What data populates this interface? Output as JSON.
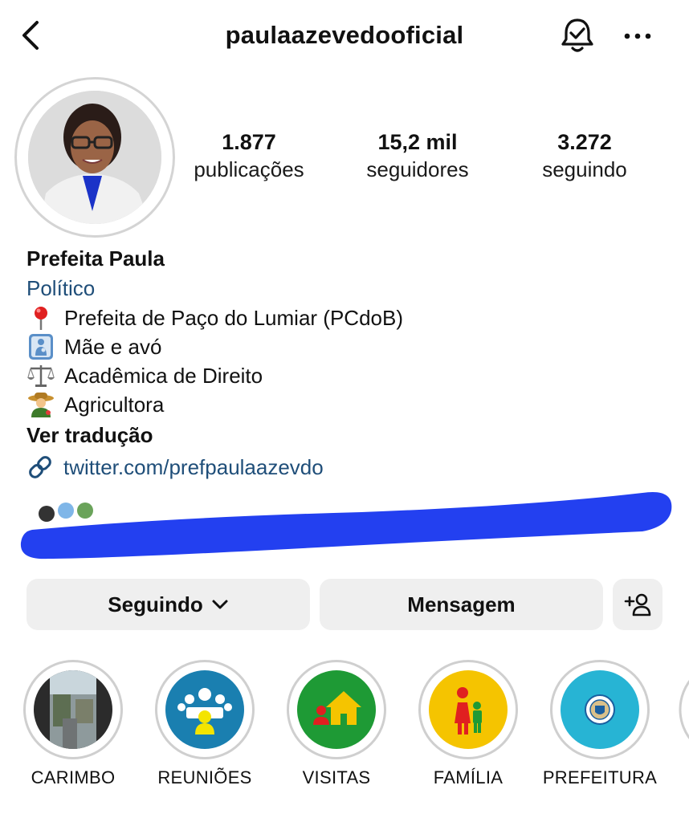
{
  "header": {
    "username": "paulaazevedooficial",
    "back_icon": "chevron-left-icon",
    "bell_icon": "bell-check-icon",
    "more_icon": "more-horizontal-icon"
  },
  "stats": {
    "posts": {
      "value": "1.877",
      "label": "publicações"
    },
    "followers": {
      "value": "15,2 mil",
      "label": "seguidores"
    },
    "following": {
      "value": "3.272",
      "label": "seguindo"
    }
  },
  "bio": {
    "name": "Prefeita Paula",
    "category": "Político",
    "lines": [
      {
        "emoji": "pin-emoji",
        "text": "Prefeita de Paço do Lumiar (PCdoB)"
      },
      {
        "emoji": "mother-child-emoji",
        "text": "Mãe e avó"
      },
      {
        "emoji": "scales-emoji",
        "text": "Acadêmica de Direito"
      },
      {
        "emoji": "farmer-emoji",
        "text": "Agricultora"
      }
    ],
    "see_translation": "Ver tradução",
    "link": "twitter.com/prefpaulaazevdo"
  },
  "actions": {
    "following_label": "Seguindo",
    "message_label": "Mensagem"
  },
  "highlights": [
    {
      "label": "CARIMBO",
      "color": "#2b2b2b"
    },
    {
      "label": "REUNIÕES",
      "color": "#1a7fb0"
    },
    {
      "label": "VISITAS",
      "color": "#1e9a35"
    },
    {
      "label": "FAMÍLIA",
      "color": "#f5c400"
    },
    {
      "label": "PREFEITURA",
      "color": "#27b4d4"
    }
  ],
  "colors": {
    "link": "#1f4e79",
    "button_bg": "#efefef",
    "scribble": "#2340f0"
  }
}
